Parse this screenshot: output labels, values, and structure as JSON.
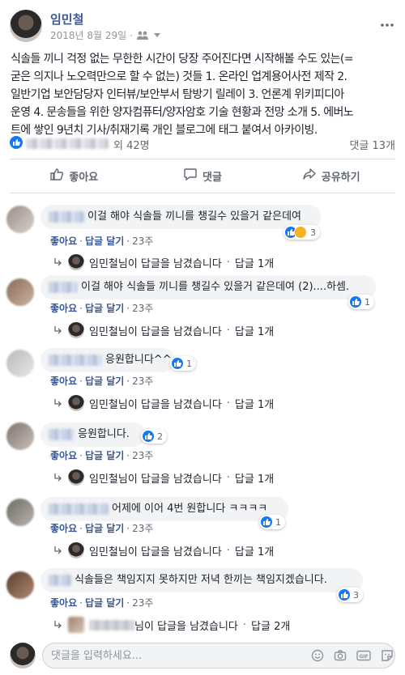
{
  "post": {
    "author": "임민철",
    "date": "2018년 8월 29일 ·",
    "body_lines": [
      "식솔들 끼니 걱정 없는 무한한 시간이 당장 주어진다면 시작해볼 수도 있는(=",
      "굳은 의지나 노오력만으로 할 수 없는) 것들 1. 온라인 업계용어사전 제작 2.",
      "일반기업 보안담당자 인터뷰/보안부서 탐방기 릴레이 3. 언론계 위키피디아",
      "운영 4. 문송들을 위한 양자컴퓨터/양자암호 기술 현황과 전망 소개 5. 에버노",
      "트에 쌓인 9년치 기사/취재기록 개인 블로그에 태그 붙여서 아카이빙."
    ],
    "reaction_summary": "외 42명",
    "comment_count": "댓글 13개"
  },
  "actions": {
    "like": "좋아요",
    "comment": "댓글",
    "share": "공유하기"
  },
  "common": {
    "like_label": "좋아요",
    "reply_label": "답글 달기",
    "age": "23주",
    "replied_by_author": "임민철님이 답글을 남겼습니다",
    "replied_suffix": "님이 답글을 남겼습니다",
    "reply_count_1": "답글 1개",
    "reply_count_2": "답글 2개"
  },
  "comments": [
    {
      "text": "이걸 해야 식솔들 끼니를 챙길수 있을거 같은데여",
      "reactions": "3"
    },
    {
      "text": "이걸 해야 식솔들 끼니를 챙길수 있을거 같은데여 (2)....하셈.",
      "reactions": "1"
    },
    {
      "text": "응원합니다^^",
      "reactions": "1"
    },
    {
      "text": "응원합니다.",
      "reactions": "2"
    },
    {
      "text": "어제에 이어 4번 원합니다 ㅋㅋㅋㅋ",
      "reactions": "1"
    },
    {
      "text": "식솔들은 책임지지 못하지만 저녁 한끼는 책임지겠습니다.",
      "reactions": "3"
    }
  ],
  "composer": {
    "placeholder": "댓글을 입력하세요..."
  },
  "colors": {
    "link": "#385898",
    "like_blue": "#1877f2",
    "meta_gray": "#90949c"
  }
}
